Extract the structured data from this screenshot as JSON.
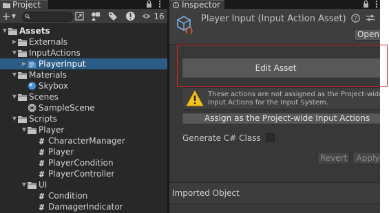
{
  "project_panel": {
    "tab_label": "Project",
    "tab_icon": "folder-icon",
    "lock_icon": "lock-icon",
    "menu_icon": "kebab-menu-icon",
    "toolbar": {
      "add_label": "+",
      "add_icon": "plus-icon",
      "search_placeholder": "",
      "search_icon": "search-icon",
      "hidden_packages_count": "16"
    },
    "tree": [
      {
        "label": "Assets",
        "kind": "folder",
        "depth": 0,
        "expanded": true,
        "bold": true
      },
      {
        "label": "Externals",
        "kind": "folder",
        "depth": 1,
        "expanded": false
      },
      {
        "label": "InputActions",
        "kind": "folder",
        "depth": 1,
        "expanded": true
      },
      {
        "label": "PlayerInput",
        "kind": "input-actions",
        "depth": 2,
        "expanded": false,
        "selected": true
      },
      {
        "label": "Materials",
        "kind": "folder",
        "depth": 1,
        "expanded": true
      },
      {
        "label": "Skybox",
        "kind": "material",
        "depth": 2
      },
      {
        "label": "Scenes",
        "kind": "folder",
        "depth": 1,
        "expanded": true
      },
      {
        "label": "SampleScene",
        "kind": "scene",
        "depth": 2
      },
      {
        "label": "Scripts",
        "kind": "folder",
        "depth": 1,
        "expanded": true
      },
      {
        "label": "Player",
        "kind": "folder",
        "depth": 2,
        "expanded": true
      },
      {
        "label": "CharacterManager",
        "kind": "script",
        "depth": 3
      },
      {
        "label": "Player",
        "kind": "script",
        "depth": 3
      },
      {
        "label": "PlayerCondition",
        "kind": "script",
        "depth": 3
      },
      {
        "label": "PlayerController",
        "kind": "script",
        "depth": 3
      },
      {
        "label": "UI",
        "kind": "folder",
        "depth": 2,
        "expanded": true
      },
      {
        "label": "Condition",
        "kind": "script",
        "depth": 3
      },
      {
        "label": "DamagerIndicator",
        "kind": "script",
        "depth": 3
      }
    ]
  },
  "inspector_panel": {
    "tab_label": "Inspector",
    "tab_icon": "info-icon",
    "header": {
      "title": "Player Input (Input Action Asset) Ir",
      "asset_icon": "input-action-asset-icon",
      "help_icon": "help-icon",
      "settings_icon": "sliders-icon",
      "open_label": "Open"
    },
    "edit_asset_label": "Edit Asset",
    "help_box": {
      "icon": "warning-icon",
      "line1": "These actions are not assigned as the Project-wide",
      "line2": "Input Actions for the Input System."
    },
    "assign_label": "Assign as the Project-wide Input Actions",
    "generate_label": "Generate C# Class",
    "generate_checked": false,
    "revert_label": "Revert",
    "apply_label": "Apply",
    "imported_object_label": "Imported Object"
  },
  "colors": {
    "selection": "#2c5d87",
    "highlight_outline": "#e02525",
    "folder": "#c2c2c2",
    "warning": "#f4c21b"
  }
}
